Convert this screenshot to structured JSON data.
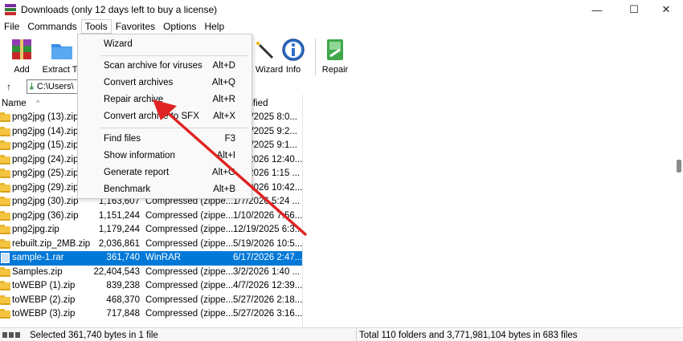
{
  "window": {
    "title": "Downloads (only 12 days left to buy a license)",
    "minimize": "—",
    "maximize": "☐",
    "close": "✕"
  },
  "menubar": [
    "File",
    "Commands",
    "Tools",
    "Favorites",
    "Options",
    "Help"
  ],
  "toolbar": {
    "add": "Add",
    "extract": "Extract To",
    "wizard": "Wizard",
    "info": "Info",
    "repair": "Repair"
  },
  "address": {
    "path": "C:\\Users\\"
  },
  "list": {
    "header_name": "Name",
    "header_modified": "Modified",
    "rows": [
      {
        "name": "png2jpg (13).zip",
        "size": "",
        "type": "",
        "modified": "1/20/2025 8:0..."
      },
      {
        "name": "png2jpg (14).zip",
        "size": "",
        "type": "",
        "modified": "1/21/2025 9:2..."
      },
      {
        "name": "png2jpg (15).zip",
        "size": "",
        "type": "",
        "modified": "1/21/2025 9:1..."
      },
      {
        "name": "png2jpg (24).zip",
        "size": "",
        "type": "",
        "modified": "1/7/2026 12:40..."
      },
      {
        "name": "png2jpg (25).zip",
        "size": "",
        "type": "",
        "modified": "1/7/2026 1:15 ..."
      },
      {
        "name": "png2jpg (29).zip",
        "size": "",
        "type": "",
        "modified": "1/7/2026 10:42..."
      },
      {
        "name": "png2jpg (30).zip",
        "size": "1,163,607",
        "type": "Compressed (zippe...",
        "modified": "1/7/2026 5:24 ..."
      },
      {
        "name": "png2jpg (36).zip",
        "size": "1,151,244",
        "type": "Compressed (zippe...",
        "modified": "1/10/2026 7:56..."
      },
      {
        "name": "png2jpg.zip",
        "size": "1,179,244",
        "type": "Compressed (zippe...",
        "modified": "12/19/2025 6:3..."
      },
      {
        "name": "rebuilt.zip_2MB.zip",
        "size": "2,036,861",
        "type": "Compressed (zippe...",
        "modified": "5/19/2026 10:5..."
      },
      {
        "name": "sample-1.rar",
        "size": "361,740",
        "type": "WinRAR",
        "modified": "6/17/2026 2:47...",
        "selected": true
      },
      {
        "name": "Samples.zip",
        "size": "22,404,543",
        "type": "Compressed (zippe...",
        "modified": "3/2/2026 1:40 ..."
      },
      {
        "name": "toWEBP (1).zip",
        "size": "839,238",
        "type": "Compressed (zippe...",
        "modified": "4/7/2026 12:39..."
      },
      {
        "name": "toWEBP (2).zip",
        "size": "468,370",
        "type": "Compressed (zippe...",
        "modified": "5/27/2026 2:18..."
      },
      {
        "name": "toWEBP (3).zip",
        "size": "717,848",
        "type": "Compressed (zippe...",
        "modified": "5/27/2026 3:16..."
      }
    ]
  },
  "tools_menu": {
    "items": [
      {
        "label": "Wizard",
        "shortcut": ""
      },
      {
        "label": "Scan archive for viruses",
        "shortcut": "Alt+D"
      },
      {
        "label": "Convert archives",
        "shortcut": "Alt+Q"
      },
      {
        "label": "Repair archive",
        "shortcut": "Alt+R"
      },
      {
        "label": "Convert archive to SFX",
        "shortcut": "Alt+X"
      },
      {
        "label": "Find files",
        "shortcut": "F3"
      },
      {
        "label": "Show information",
        "shortcut": "Alt+I"
      },
      {
        "label": "Generate report",
        "shortcut": "Alt+G"
      },
      {
        "label": "Benchmark",
        "shortcut": "Alt+B"
      }
    ]
  },
  "status": {
    "left": "Selected 361,740 bytes in 1 file",
    "right": "Total 110 folders and 3,771,981,104 bytes in 683 files"
  },
  "colors": {
    "selection": "#0078d7",
    "annotation_arrow": "#e02424"
  }
}
